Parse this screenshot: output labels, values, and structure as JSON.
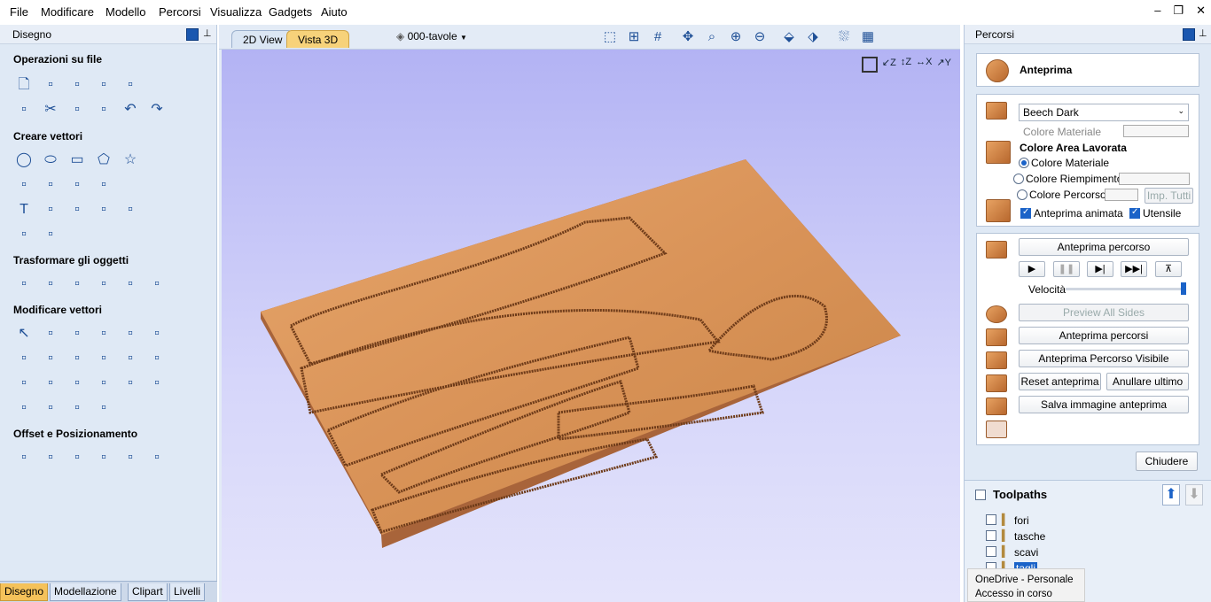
{
  "menu": [
    "File",
    "Modificare",
    "Modello",
    "Percorsi",
    "Visualizza",
    "Gadgets",
    "Aiuto"
  ],
  "left_panel": {
    "title": "Disegno",
    "sections": [
      "Operazioni su file",
      "Creare vettori",
      "Trasformare gli oggetti",
      "Modificare vettori",
      "Offset e Posizionamento"
    ],
    "tabs": [
      "Disegno",
      "Modellazione",
      "Clipart",
      "Livelli"
    ]
  },
  "view": {
    "tabs": [
      "2D View",
      "Vista 3D"
    ],
    "active_tab": "Vista 3D",
    "layer_selector": "000-tavole"
  },
  "right_panel": {
    "title": "Percorsi",
    "preview": {
      "title": "Anteprima",
      "material": "Beech Dark",
      "material_color_label": "Colore Materiale",
      "machined_area_heading": "Colore Area Lavorata",
      "radio_material": "Colore Materiale",
      "radio_fill": "Colore Riempimento",
      "radio_toolpath": "Colore Percorso",
      "imp_all": "Imp. Tutti",
      "animated_label": "Anteprima animata",
      "animated_checked": true,
      "tool_label": "Utensile",
      "tool_checked": true,
      "btn_preview_toolpath": "Anteprima percorso",
      "speed_label": "Velocità",
      "speed_level": 1.0,
      "btn_preview_all_sides": "Preview All Sides",
      "btn_preview_toolpaths": "Anteprima percorsi",
      "btn_preview_visible": "Anteprima Percorso Visibile",
      "btn_reset": "Reset anteprima",
      "btn_undo_last": "Anullare ultimo",
      "btn_save_image": "Salva immagine anteprima",
      "btn_close": "Chiudere"
    },
    "toolpaths": {
      "title": "Toolpaths",
      "items": [
        "fori",
        "tasche",
        "scavi",
        "tagli"
      ]
    }
  },
  "notification": {
    "line1": "OneDrive - Personale",
    "line2": "Accesso in corso"
  },
  "colors": {
    "wood": "#d99358",
    "accent": "#1b63c8",
    "panel_bg": "#dfe9f5"
  }
}
